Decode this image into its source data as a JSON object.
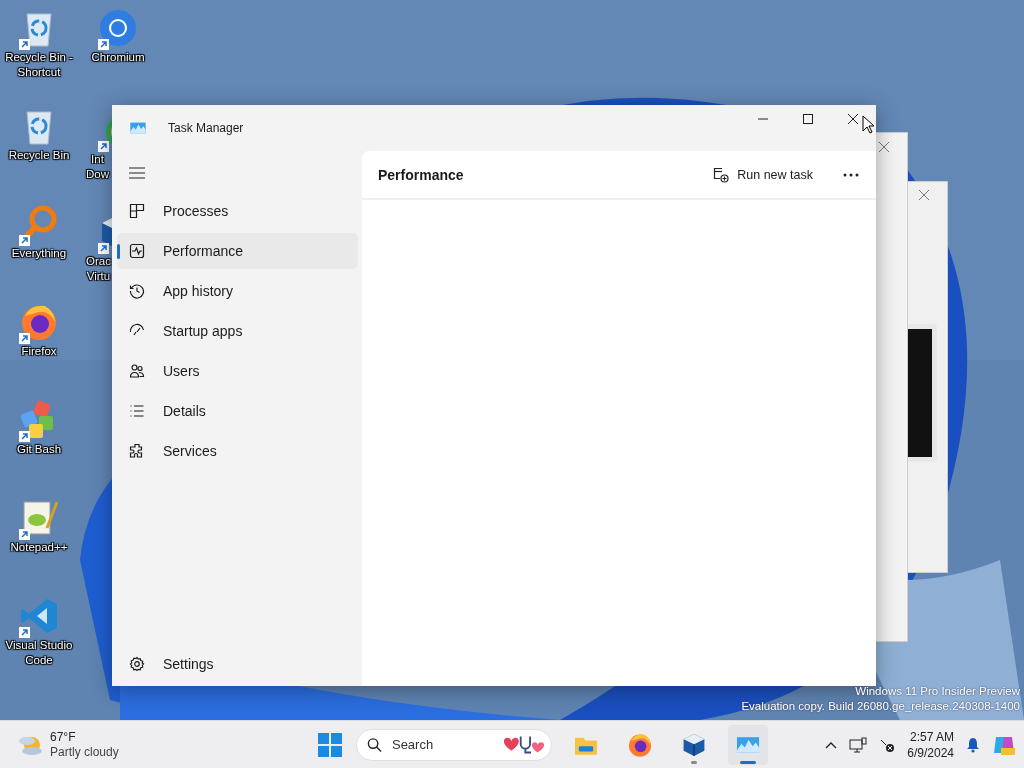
{
  "desktop_icons": [
    {
      "label": "Recycle Bin - Shortcut",
      "kind": "recycle",
      "shortcut": true
    },
    {
      "label": "Recycle Bin",
      "kind": "recycle",
      "shortcut": false
    },
    {
      "label": "Everything",
      "kind": "everything",
      "shortcut": true
    },
    {
      "label": "Firefox",
      "kind": "firefox",
      "shortcut": true
    },
    {
      "label": "Git Bash",
      "kind": "gitbash",
      "shortcut": true
    },
    {
      "label": "Notepad++",
      "kind": "notepad",
      "shortcut": true
    },
    {
      "label": "Visual Studio Code",
      "kind": "vscode",
      "shortcut": true
    }
  ],
  "desktop_icons_2": [
    {
      "label": "Chromium",
      "kind": "chromium",
      "shortcut": true
    },
    {
      "label": "Int\nDow",
      "kind": "rainbow",
      "shortcut": true
    },
    {
      "label": "Orac\nVirtu",
      "kind": "virtualbox",
      "shortcut": true
    }
  ],
  "window": {
    "title": "Task Manager"
  },
  "nav": [
    {
      "label": "Processes",
      "kind": "processes",
      "selected": false
    },
    {
      "label": "Performance",
      "kind": "performance",
      "selected": true
    },
    {
      "label": "App history",
      "kind": "history",
      "selected": false
    },
    {
      "label": "Startup apps",
      "kind": "startup",
      "selected": false
    },
    {
      "label": "Users",
      "kind": "users",
      "selected": false
    },
    {
      "label": "Details",
      "kind": "details",
      "selected": false
    },
    {
      "label": "Services",
      "kind": "services",
      "selected": false
    }
  ],
  "settings": {
    "label": "Settings"
  },
  "page": {
    "title": "Performance",
    "action": "Run new task"
  },
  "watermark": [
    "Windows 11 Pro Insider Preview",
    "Evaluation copy. Build 26080.ge_release.240308-1400"
  ],
  "taskbar": {
    "weather": {
      "temp": "67°F",
      "condition": "Partly cloudy"
    },
    "search": {
      "placeholder": "Search"
    },
    "apps": [
      {
        "kind": "files",
        "running": false,
        "selected": false
      },
      {
        "kind": "firefox",
        "running": false,
        "selected": false
      },
      {
        "kind": "virtualbox",
        "running": true,
        "selected": false
      },
      {
        "kind": "taskmanager",
        "running": true,
        "selected": true
      }
    ],
    "clock": {
      "time": "2:57 AM",
      "date": "6/9/2024"
    }
  }
}
